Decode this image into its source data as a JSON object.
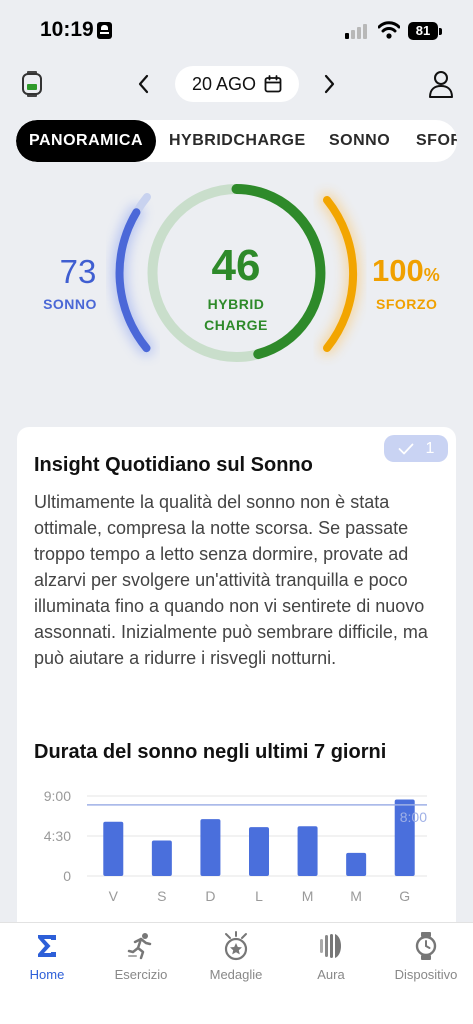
{
  "status_bar": {
    "time": "10:19",
    "battery": "81"
  },
  "header": {
    "date": "20 AGO"
  },
  "tabs": [
    {
      "label": "PANORAMICA",
      "active": true
    },
    {
      "label": "HYBRIDCHARGE",
      "active": false
    },
    {
      "label": "SONNO",
      "active": false
    },
    {
      "label": "SFORZO",
      "active": false
    }
  ],
  "gauges": {
    "sleep": {
      "value": "73",
      "label": "SONNO",
      "color": "#4a67d6"
    },
    "hybrid_charge": {
      "value": "46",
      "label_line1": "HYBRID",
      "label_line2": "CHARGE",
      "color": "#2e8a2a"
    },
    "effort": {
      "value": "100",
      "unit": "%",
      "label": "SFORZO",
      "color": "#f0a000"
    }
  },
  "insight": {
    "badge_count": "1",
    "title": "Insight Quotidiano sul Sonno",
    "body": "Ultimamente la qualità del sonno non è stata ottimale, compresa la notte scorsa. Se passate troppo tempo a letto senza dormire, provate ad alzarvi per svolgere un'attività tranquilla e poco illuminata fino a quando non vi sentirete di nuovo assonnati. Inizialmente può sembrare difficile, ma può aiutare a ridurre i risvegli notturni."
  },
  "chart_title": "Durata del sonno negli ultimi 7 giorni",
  "chart_data": {
    "type": "bar",
    "categories": [
      "V",
      "S",
      "D",
      "L",
      "M",
      "M",
      "G"
    ],
    "values": [
      6.1,
      4.0,
      6.4,
      5.5,
      5.6,
      2.6,
      8.6
    ],
    "y_ticks": [
      "0",
      "4:30",
      "9:00"
    ],
    "ylim": [
      0,
      9
    ],
    "reference_line": {
      "value": 8,
      "label": "8:00"
    },
    "bar_color": "#4a6fdc",
    "grid": true
  },
  "bottom_nav": [
    {
      "label": "Home",
      "icon": "sigma-icon",
      "active": true
    },
    {
      "label": "Esercizio",
      "icon": "running-icon",
      "active": false
    },
    {
      "label": "Medaglie",
      "icon": "medal-icon",
      "active": false
    },
    {
      "label": "Aura",
      "icon": "aura-icon",
      "active": false
    },
    {
      "label": "Dispositivo",
      "icon": "watch-icon",
      "active": false
    }
  ]
}
